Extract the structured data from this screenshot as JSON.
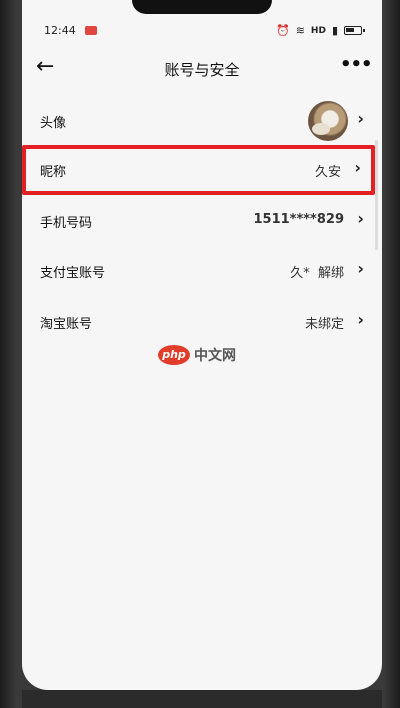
{
  "status_bar": {
    "time": "12:44",
    "network": "HD"
  },
  "header": {
    "title": "账号与安全",
    "back_icon": "arrow-left-icon",
    "more_icon": "more-dots-icon"
  },
  "rows": [
    {
      "label": "头像",
      "value": "",
      "has_avatar": true
    },
    {
      "label": "昵称",
      "value": "久安"
    },
    {
      "label": "手机号码",
      "value": "1511****829"
    },
    {
      "label": "支付宝账号",
      "value": "久*  解绑"
    },
    {
      "label": "淘宝账号",
      "value": "未绑定"
    }
  ],
  "colors": {
    "highlight_border": "#e32024",
    "background": "#f6f6f6"
  },
  "watermark": {
    "logo_text": "php",
    "text": "中文网"
  }
}
